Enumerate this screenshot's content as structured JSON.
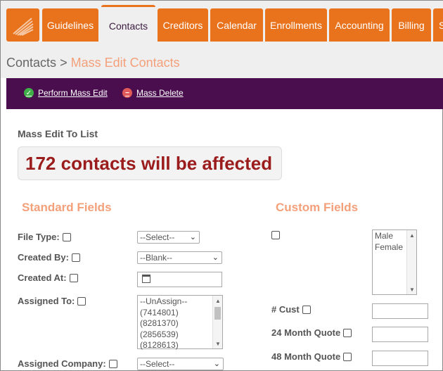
{
  "nav": {
    "tabs": [
      "Guidelines",
      "Contacts",
      "Creditors",
      "Calendar",
      "Enrollments",
      "Accounting",
      "Billing",
      "S"
    ],
    "active_tab": "Contacts"
  },
  "breadcrumb": {
    "parent": "Contacts",
    "separator": ">",
    "current": "Mass Edit Contacts"
  },
  "actions": {
    "perform": "Perform Mass Edit",
    "delete": "Mass Delete"
  },
  "mass_edit": {
    "label": "Mass Edit To List",
    "affected_text": "172 contacts will be affected"
  },
  "standard_fields": {
    "heading": "Standard Fields",
    "file_type": {
      "label": "File Type:",
      "value": "--Select--"
    },
    "created_by": {
      "label": "Created By:",
      "value": "--Blank--"
    },
    "created_at": {
      "label": "Created At:"
    },
    "assigned_to": {
      "label": "Assigned To:",
      "options": [
        "--UnAssign--",
        "(7414801)",
        "(8281370)",
        "(2856539)",
        "(8128613)"
      ]
    },
    "assigned_company": {
      "label": "Assigned Company:",
      "value": "--Select--"
    }
  },
  "custom_fields": {
    "heading": "Custom Fields",
    "gender_options": [
      "Male",
      "Female"
    ],
    "cust": {
      "label": "# Cust"
    },
    "quote24": {
      "label": "24 Month Quote"
    },
    "quote48": {
      "label": "48 Month Quote"
    }
  },
  "colors": {
    "accent_orange": "#e8731c",
    "header_purple": "#4a0e4e",
    "heading_salmon": "#f4a07a",
    "affected_red": "#9b1c1c"
  }
}
